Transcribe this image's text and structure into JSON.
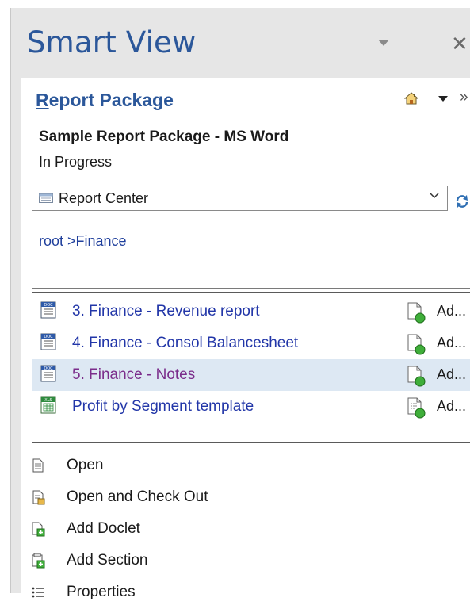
{
  "pane": {
    "title": "Smart View",
    "close_glyph": "✕"
  },
  "panel": {
    "title_first": "R",
    "title_rest": "eport Package",
    "more_glyph": "»",
    "package_name": "Sample Report Package - MS Word",
    "package_status": "In Progress",
    "combo_value": "Report Center",
    "breadcrumb": "root   >Finance"
  },
  "doclets": [
    {
      "label": "3. Finance - Revenue report",
      "type": "DOC",
      "status": "Ad...",
      "selected": false
    },
    {
      "label": "4. Finance - Consol Balancesheet",
      "type": "DOC",
      "status": "Ad...",
      "selected": false
    },
    {
      "label": "5. Finance - Notes",
      "type": "DOC",
      "status": "Ad...",
      "selected": true
    },
    {
      "label": "Profit by Segment template",
      "type": "XLS",
      "status": "Ad...",
      "selected": false
    }
  ],
  "actions": [
    {
      "label": "Open",
      "icon": "open-icon"
    },
    {
      "label": "Open and Check Out",
      "icon": "check-out-icon"
    },
    {
      "label": "Add Doclet",
      "icon": "add-doclet-icon"
    },
    {
      "label": "Add Section",
      "icon": "add-section-icon"
    },
    {
      "label": "Properties",
      "icon": "properties-icon"
    }
  ],
  "colors": {
    "accent": "#2b579a",
    "link": "#2236a8",
    "visited": "#7b2d8b",
    "selection": "#dde8f3"
  }
}
